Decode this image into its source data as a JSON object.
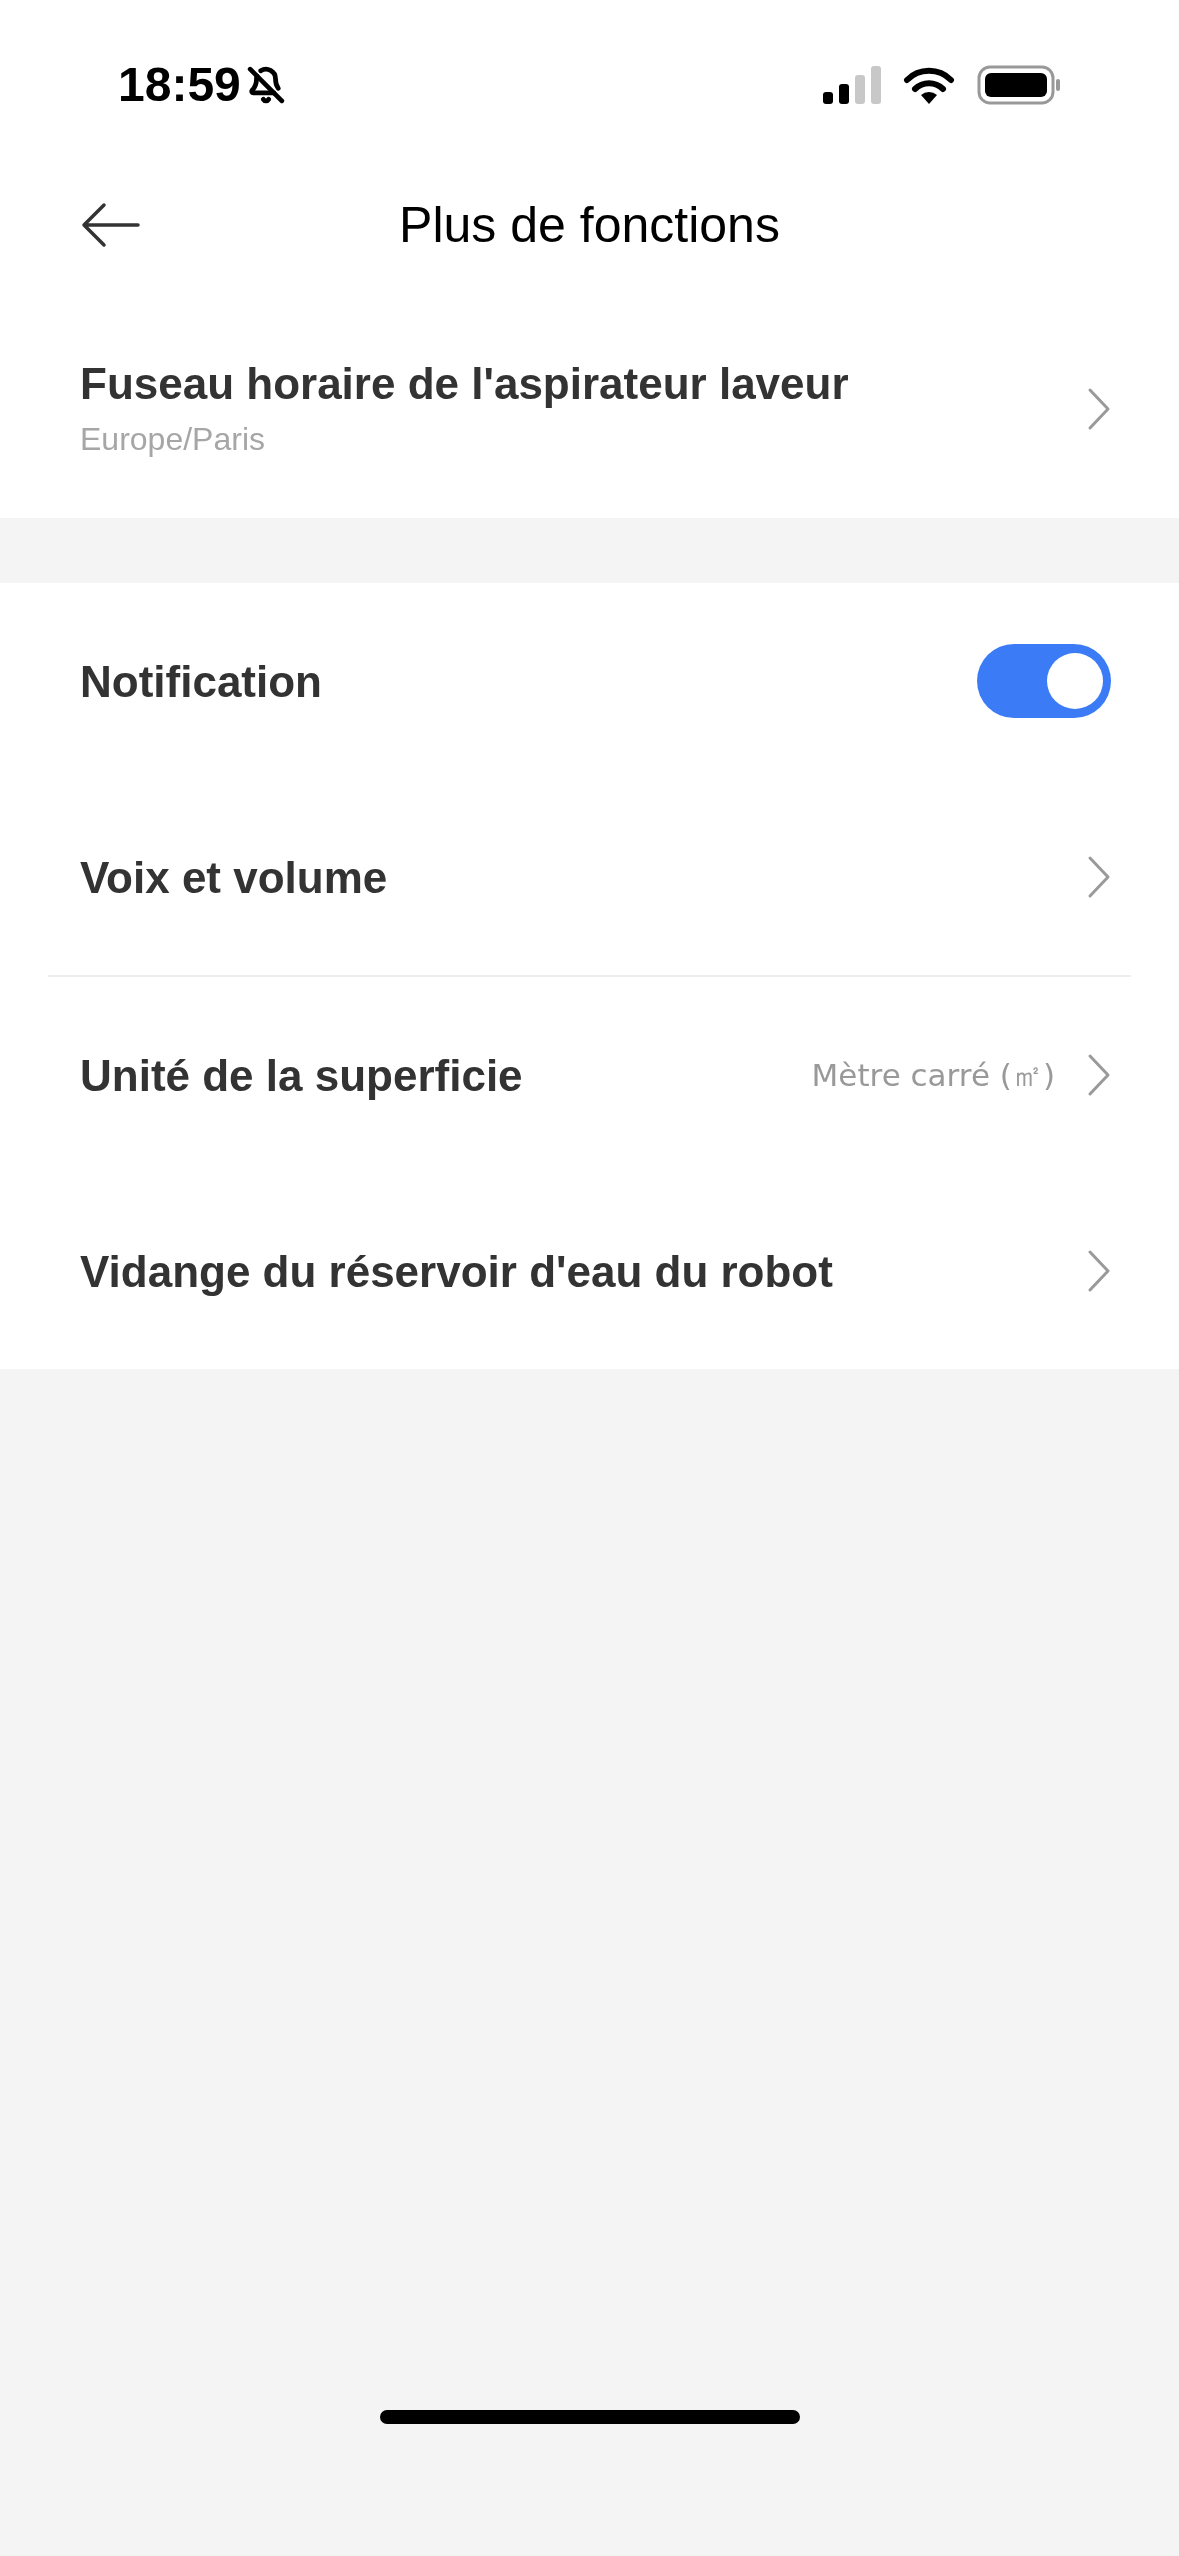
{
  "status_bar": {
    "time": "18:59"
  },
  "header": {
    "title": "Plus de fonctions"
  },
  "sections": [
    {
      "rows": [
        {
          "kind": "link",
          "title": "Fuseau horaire de l'aspirateur laveur",
          "subtitle": "Europe/Paris"
        }
      ]
    },
    {
      "rows": [
        {
          "kind": "toggle",
          "title": "Notification",
          "on": true
        },
        {
          "kind": "link",
          "title": "Voix et volume",
          "divider_below": true
        },
        {
          "kind": "link",
          "title": "Unité de la superficie",
          "value": "Mètre carré (㎡)"
        },
        {
          "kind": "link",
          "title": "Vidange du réservoir d'eau du robot"
        }
      ]
    }
  ]
}
